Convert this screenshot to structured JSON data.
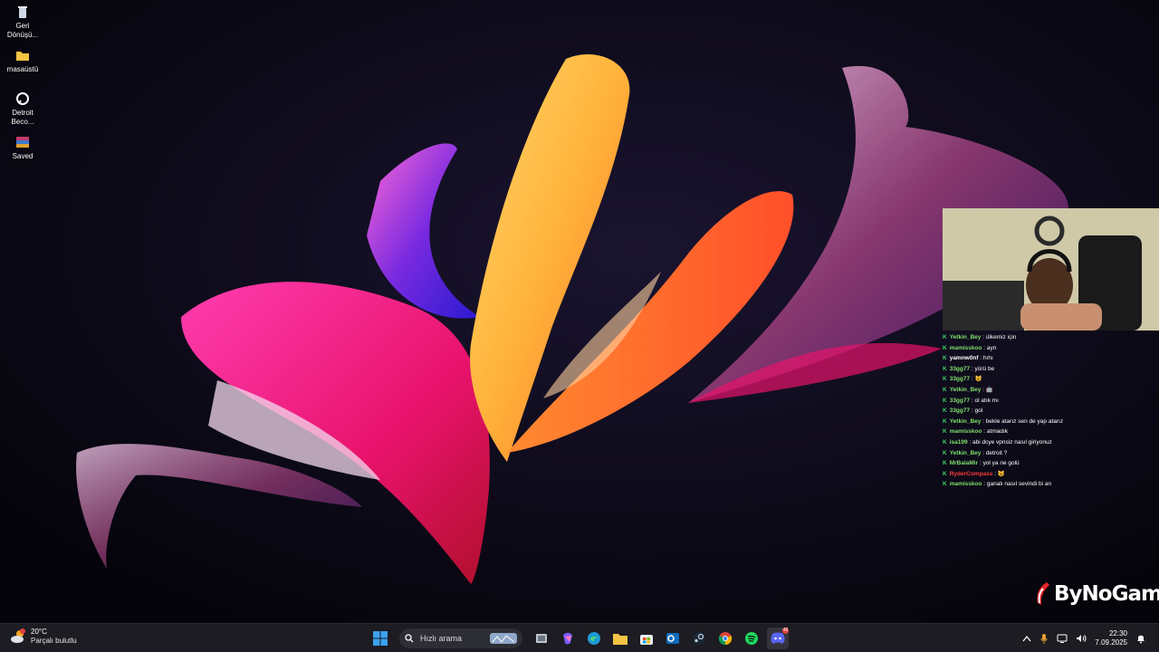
{
  "desktop": {
    "icons": [
      {
        "label": "Geri\nDönüşü...",
        "icon": "recycle-bin-icon"
      },
      {
        "label": "masaüstü",
        "icon": "folder-icon"
      },
      {
        "label": "Detroit\nBeco...",
        "icon": "game-shortcut-icon"
      },
      {
        "label": "Saved",
        "icon": "archive-icon"
      }
    ]
  },
  "chat": {
    "messages": [
      {
        "user": "Yetkin_Bey",
        "color": "#7ee06a",
        "text": "ülkemiz için"
      },
      {
        "user": "mamisskoo",
        "color": "#7ee06a",
        "text": "ayn"
      },
      {
        "user": "yamnw0nf",
        "color": "#ffffff",
        "text": "hıhı"
      },
      {
        "user": "33gg77",
        "color": "#7ee06a",
        "text": "yürü be"
      },
      {
        "user": "33gg77",
        "color": "#7ee06a",
        "text": "😺"
      },
      {
        "user": "Yetkin_Bey",
        "color": "#7ee06a",
        "text": "🤖"
      },
      {
        "user": "33gg77",
        "color": "#7ee06a",
        "text": "ol atık mı"
      },
      {
        "user": "33gg77",
        "color": "#7ee06a",
        "text": "gol"
      },
      {
        "user": "Yetkin_Bey",
        "color": "#7ee06a",
        "text": "bekle atarız sen de yap atarız"
      },
      {
        "user": "mamisskoo",
        "color": "#7ee06a",
        "text": "atmadık"
      },
      {
        "user": "isa199",
        "color": "#7ee06a",
        "text": "abi dcye vpnsiz nasıl giriyonuz"
      },
      {
        "user": "Yetkin_Bey",
        "color": "#7ee06a",
        "text": "detroit ?"
      },
      {
        "user": "MrBalaMir",
        "color": "#7ee06a",
        "text": "yol ya ne golü"
      },
      {
        "user": "RyderCompass",
        "color": "#ff3b3b",
        "text": "😺"
      },
      {
        "user": "mamisskoo",
        "color": "#7ee06a",
        "text": "ganalı nasıl sevindi bi an"
      }
    ]
  },
  "brand": {
    "text": "ByNoGame"
  },
  "taskbar": {
    "weather": {
      "temp": "20°C",
      "condition": "Parçalı bulutlu",
      "icon": "weather-cloud-icon"
    },
    "search_placeholder": "Hızlı arama",
    "apps": [
      "start-icon",
      "task-view-icon",
      "copilot-icon",
      "edge-icon",
      "file-explorer-icon",
      "store-icon",
      "outlook-icon",
      "steam-icon",
      "chrome-icon",
      "spotify-icon",
      "discord-icon"
    ],
    "discord_badge": "49",
    "clock": {
      "time": "22:30",
      "date": "7.09.2025"
    },
    "colors": {
      "accent": "#3b82f6",
      "taskbar": "#1c1c22"
    }
  }
}
